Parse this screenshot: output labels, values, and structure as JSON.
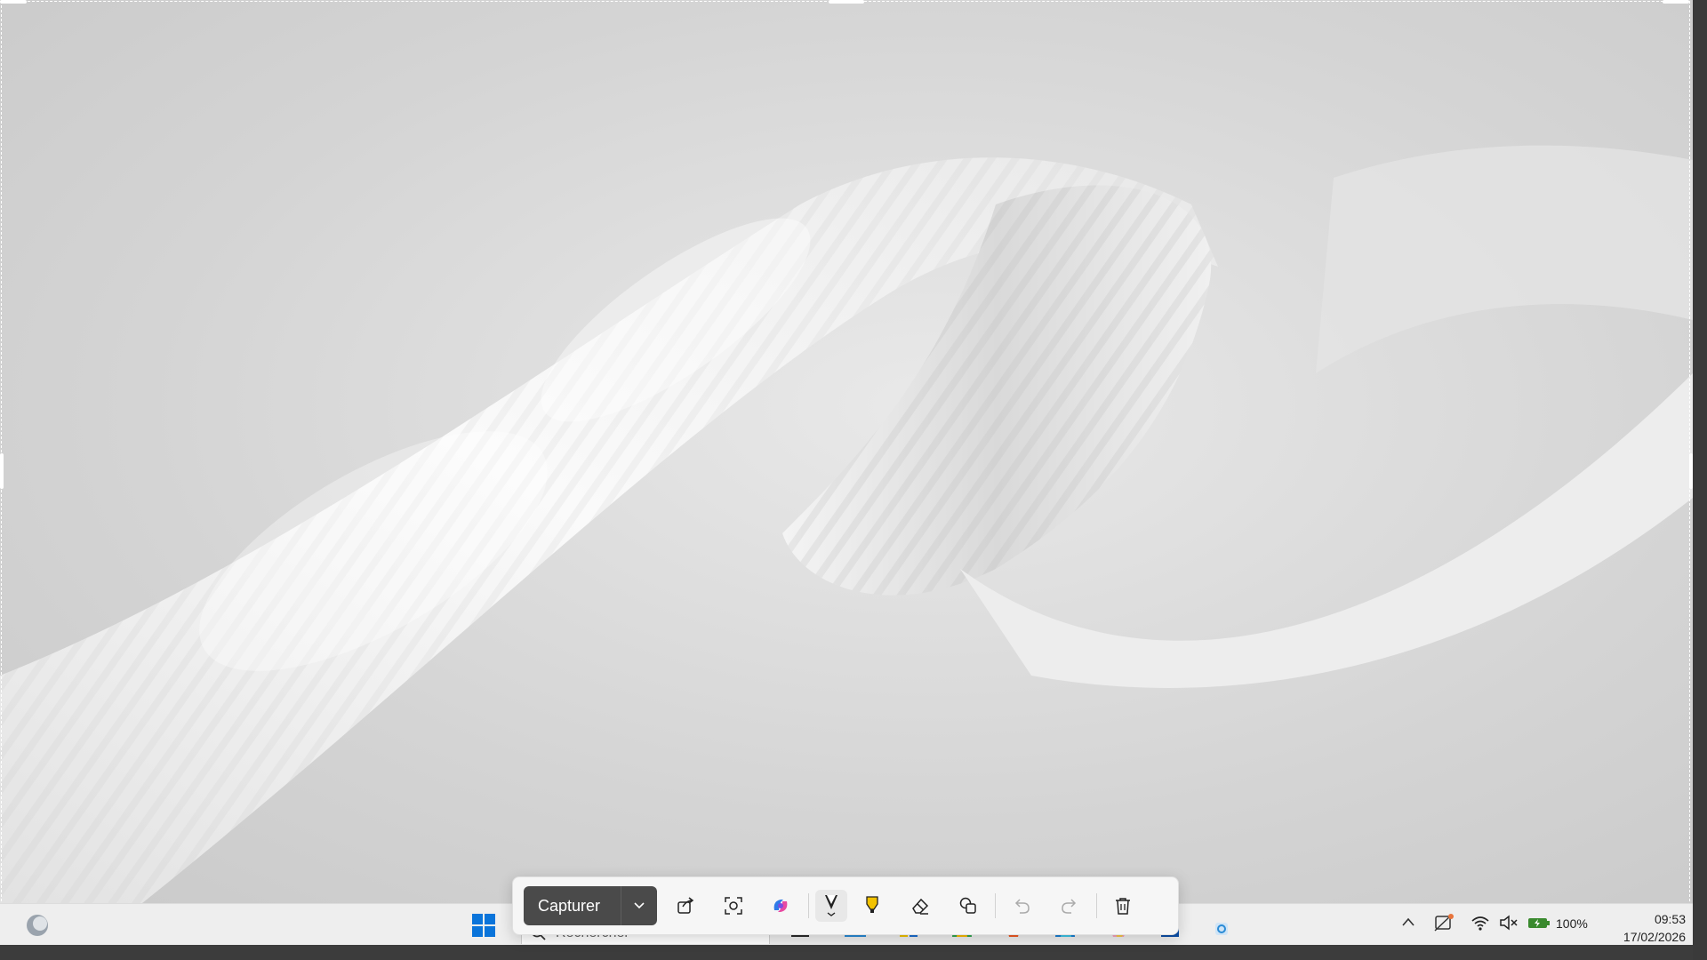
{
  "snip_toolbar": {
    "capture_label": "Capturer",
    "tools": [
      "share-icon",
      "text-actions-icon",
      "copilot-icon",
      "pen-icon",
      "highlighter-icon",
      "eraser-icon",
      "shapes-icon",
      "undo-icon",
      "redo-icon",
      "delete-icon"
    ]
  },
  "taskbar": {
    "search_placeholder": "Rechercher",
    "battery": "100%",
    "time": "09:53",
    "date": "17/02/2026"
  },
  "colors": {
    "capture_button": "#4a4a4a",
    "highlighter": "#f2c200",
    "windows_blue": "#0a74da"
  }
}
